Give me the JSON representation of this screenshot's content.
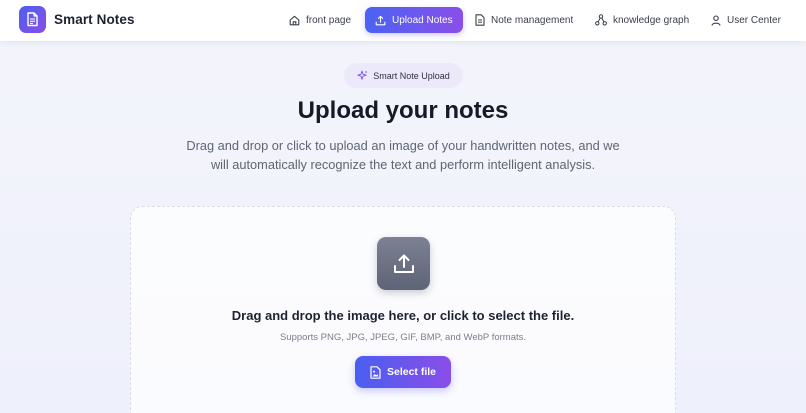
{
  "header": {
    "brand": "Smart Notes",
    "nav": [
      {
        "label": "front page",
        "icon": "home-icon",
        "active": false
      },
      {
        "label": "Upload Notes",
        "icon": "upload-icon",
        "active": true
      },
      {
        "label": "Note management",
        "icon": "document-icon",
        "active": false
      },
      {
        "label": "knowledge graph",
        "icon": "graph-icon",
        "active": false
      },
      {
        "label": "User Center",
        "icon": "user-icon",
        "active": false
      }
    ]
  },
  "hero": {
    "badge": "Smart Note Upload",
    "title": "Upload your notes",
    "subtitle": "Drag and drop or click to upload an image of your handwritten notes, and we will automatically recognize the text and perform intelligent analysis."
  },
  "upload": {
    "heading": "Drag and drop the image here, or click to select the file.",
    "formats": "Supports PNG, JPG, JPEG, GIF, BMP, and WebP formats.",
    "button_label": "Select file"
  },
  "colors": {
    "accent_start": "#4a5ff0",
    "accent_end": "#8a4de9"
  }
}
